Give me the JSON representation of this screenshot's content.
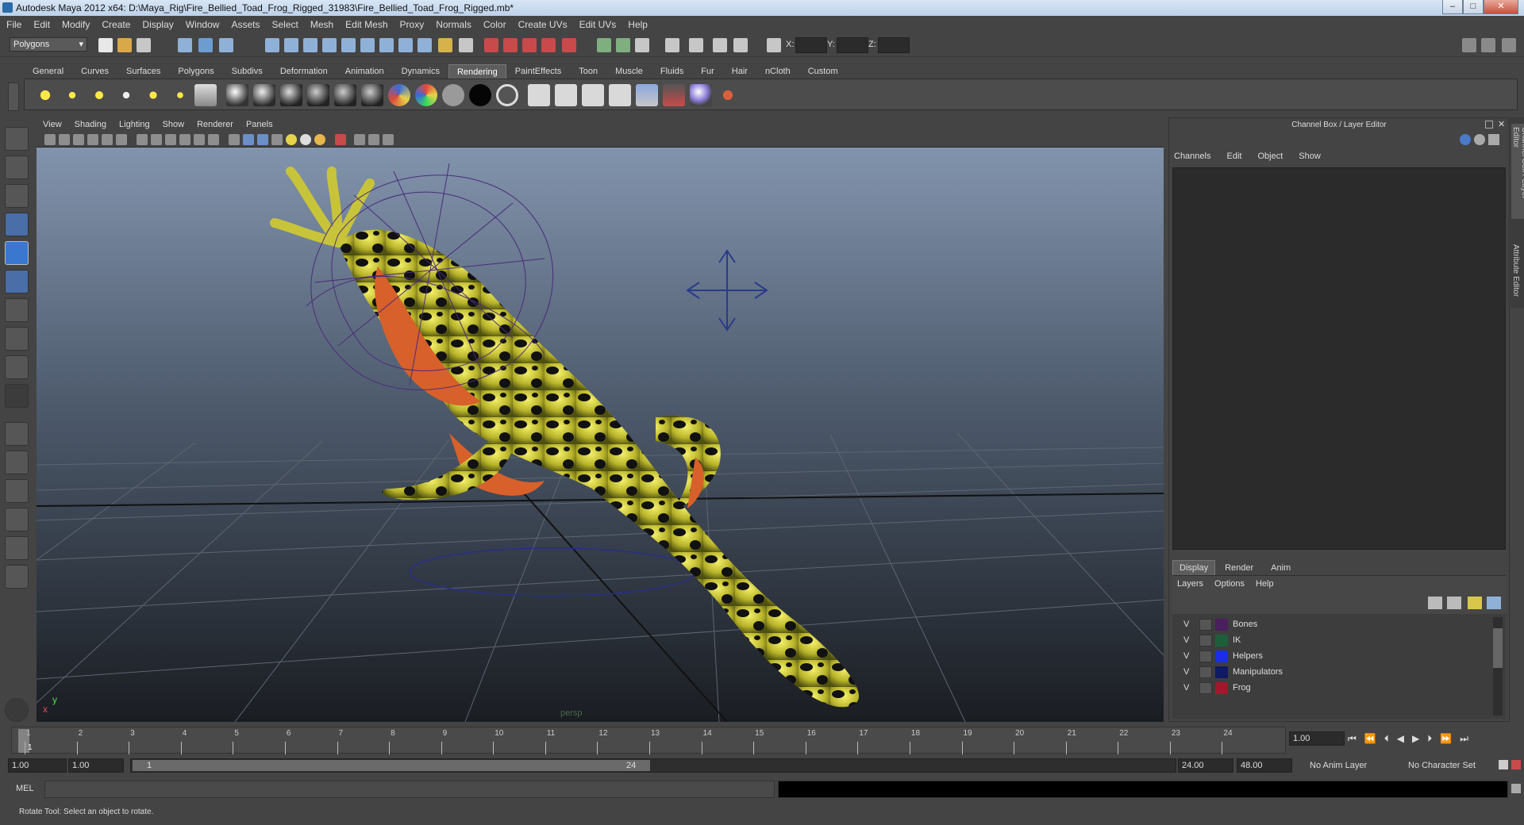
{
  "window": {
    "title": "Autodesk Maya 2012 x64: D:\\Maya_Rig\\Fire_Bellied_Toad_Frog_Rigged_31983\\Fire_Bellied_Toad_Frog_Rigged.mb*",
    "minimize": "–",
    "maximize": "□",
    "close": "✕"
  },
  "menu": [
    "File",
    "Edit",
    "Modify",
    "Create",
    "Display",
    "Window",
    "Assets",
    "Select",
    "Mesh",
    "Edit Mesh",
    "Proxy",
    "Normals",
    "Color",
    "Create UVs",
    "Edit UVs",
    "Help"
  ],
  "statusline": {
    "menuset": "Polygons",
    "x_label": "X:",
    "y_label": "Y:",
    "z_label": "Z:"
  },
  "shelf": {
    "tabs": [
      "General",
      "Curves",
      "Surfaces",
      "Polygons",
      "Subdivs",
      "Deformation",
      "Animation",
      "Dynamics",
      "Rendering",
      "PaintEffects",
      "Toon",
      "Muscle",
      "Fluids",
      "Fur",
      "Hair",
      "nCloth",
      "Custom"
    ],
    "active": "Rendering"
  },
  "viewport": {
    "menus": [
      "View",
      "Shading",
      "Lighting",
      "Show",
      "Renderer",
      "Panels"
    ],
    "camera_label": "persp",
    "axis_y": "y",
    "axis_x": "x",
    "axis_z": "z"
  },
  "channel_box": {
    "title": "Channel Box / Layer Editor",
    "menus": [
      "Channels",
      "Edit",
      "Object",
      "Show"
    ]
  },
  "side_tabs": {
    "channel_box": "Channel Box / Layer Editor",
    "attribute_editor": "Attribute Editor"
  },
  "layer_editor": {
    "tabs": [
      "Display",
      "Render",
      "Anim"
    ],
    "active_tab": "Display",
    "menus": [
      "Layers",
      "Options",
      "Help"
    ],
    "layers": [
      {
        "v": "V",
        "name": "Bones",
        "color": "#4a1f5e"
      },
      {
        "v": "V",
        "name": "IK",
        "color": "#1e5e3a"
      },
      {
        "v": "V",
        "name": "Helpers",
        "color": "#1b2ee6"
      },
      {
        "v": "V",
        "name": "Manipulators",
        "color": "#0f1a63"
      },
      {
        "v": "V",
        "name": "Frog",
        "color": "#a3162b"
      }
    ]
  },
  "timeline": {
    "ticks": [
      "1",
      "2",
      "3",
      "4",
      "5",
      "6",
      "7",
      "8",
      "9",
      "10",
      "11",
      "12",
      "13",
      "14",
      "15",
      "16",
      "17",
      "18",
      "19",
      "20",
      "21",
      "22",
      "23",
      "24"
    ],
    "current_frame": "1",
    "current_time_field": "1.00"
  },
  "range": {
    "start_time": "1.00",
    "playback_start": "1.00",
    "range_start_label": "1",
    "range_end_label": "24",
    "playback_end": "24.00",
    "end_time": "48.00",
    "anim_layer": "No Anim Layer",
    "character_set": "No Character Set"
  },
  "command_line": {
    "label": "MEL"
  },
  "help_line": {
    "text": "Rotate Tool: Select an object to rotate."
  }
}
